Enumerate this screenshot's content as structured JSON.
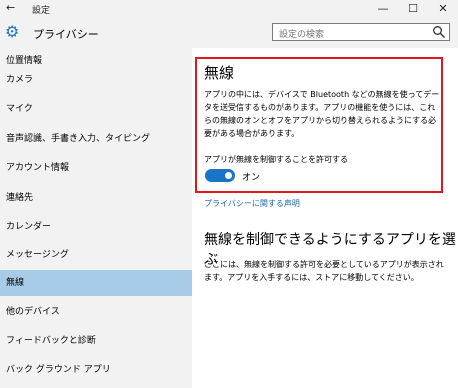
{
  "window": {
    "back_glyph": "←",
    "title": "設定",
    "minimize_glyph": "—",
    "maximize_glyph": "☐",
    "close_glyph": "✕"
  },
  "header": {
    "page_title": "プライバシー",
    "search_placeholder": "設定の検索"
  },
  "sidebar": {
    "items": [
      {
        "label": "位置情報"
      },
      {
        "label": "カメラ"
      },
      {
        "label": "マイク"
      },
      {
        "label": "音声認識、手書き入力、タイピング"
      },
      {
        "label": "アカウント情報"
      },
      {
        "label": "連絡先"
      },
      {
        "label": "カレンダー"
      },
      {
        "label": "メッセージング"
      },
      {
        "label": "無線",
        "selected": true
      },
      {
        "label": "他のデバイス"
      },
      {
        "label": "フィードバックと診断"
      },
      {
        "label": "バック グラウンド アプリ"
      }
    ]
  },
  "main": {
    "heading": "無線",
    "description": "アプリの中には、デバイスで Bluetooth などの無線を使ってデータを送受信するものがあります。アプリの機能を使うには、これらの無線のオンとオフをアプリから切り替えられるようにする必要がある場合があります。",
    "toggle_label": "アプリが無線を制御することを許可する",
    "toggle_state": "オン",
    "privacy_link": "プライバシーに関する声明",
    "section_heading": "無線を制御できるようにするアプリを選ぶ",
    "section_description": "ここには、無線を制御する許可を必要としているアプリが表示されます。アプリを入手するには、ストアに移動してください。"
  },
  "colors": {
    "accent": "#1a74c8",
    "selected_bg": "#a8cbe8",
    "highlight_border": "#e0171d",
    "sidebar_bg": "#f2f2f2"
  }
}
